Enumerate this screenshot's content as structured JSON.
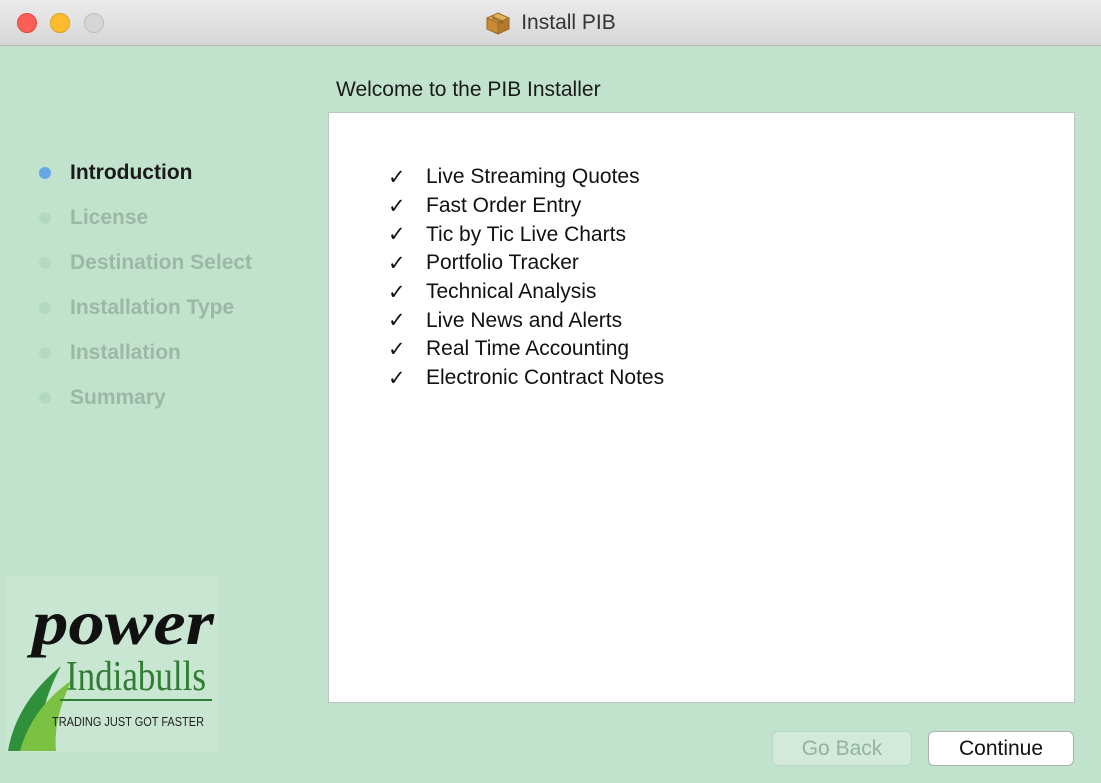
{
  "window": {
    "title": "Install PIB",
    "title_icon": "package-icon"
  },
  "heading": "Welcome to the PIB Installer",
  "steps": [
    {
      "label": "Introduction",
      "active": true
    },
    {
      "label": "License",
      "active": false
    },
    {
      "label": "Destination Select",
      "active": false
    },
    {
      "label": "Installation Type",
      "active": false
    },
    {
      "label": "Installation",
      "active": false
    },
    {
      "label": "Summary",
      "active": false
    }
  ],
  "features": {
    "check_glyph": "✓",
    "items": [
      "Live Streaming Quotes",
      "Fast Order Entry",
      "Tic by Tic Live Charts",
      "Portfolio Tracker",
      "Technical Analysis",
      "Live News and Alerts",
      "Real Time Accounting",
      "Electronic Contract Notes"
    ]
  },
  "logo": {
    "word": "power",
    "brand": "Indiabulls",
    "tagline": "TRADING JUST GOT FASTER"
  },
  "buttons": {
    "back_label": "Go Back",
    "continue_label": "Continue"
  },
  "colors": {
    "background": "#c1e3cd",
    "active_dot": "#67a7e6",
    "close": "#fc5f57",
    "minimize": "#fdbc2e"
  }
}
